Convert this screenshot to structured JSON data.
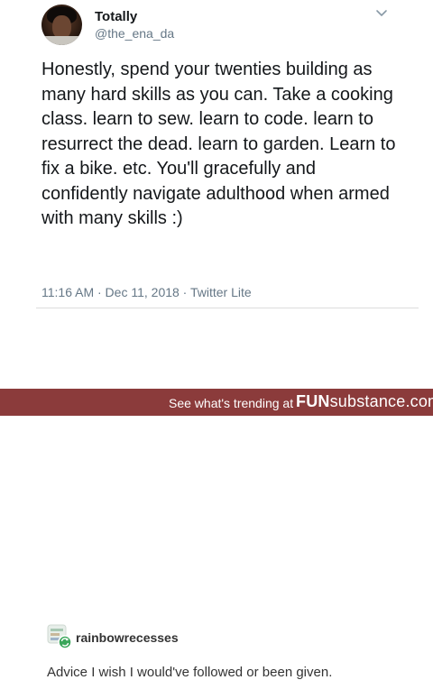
{
  "tweet": {
    "author_name": "Totally",
    "author_handle": "@the_ena_da",
    "text": "Honestly, spend your twenties building as many hard skills as you can. Take a cooking class. learn to sew. learn to code. learn to resurrect the dead. learn to garden. Learn to fix a bike. etc. You'll gracefully and confidently navigate adulthood when armed with many skills :)",
    "meta": "11:16 AM · Dec 11, 2018 · Twitter Lite",
    "icons": {
      "menu": "chevron-down-icon",
      "avatar": "avatar"
    }
  },
  "reply": {
    "username": "rainbowrecesses",
    "text": "Advice I wish I would've followed or been given.",
    "icons": {
      "reblog": "reblog-icon"
    }
  },
  "footer": {
    "trend_text": "See what's trending at",
    "brand_bold": "FUN",
    "brand_rest": "substance.com",
    "bg_color": "#8b3b3b"
  }
}
